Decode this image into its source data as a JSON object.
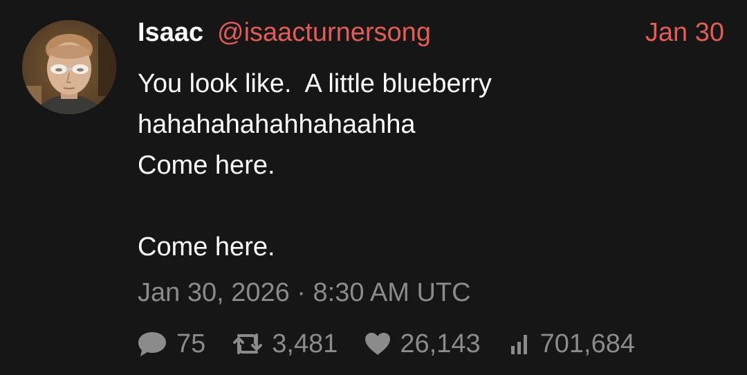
{
  "author": {
    "name": "Isaac",
    "handle": "@isaacturnersong",
    "date": "Jan 30",
    "avatar_icon": "profile-photo"
  },
  "body": {
    "lines": [
      "You look like.  A little blueberry",
      "hahahahahahhahaahha",
      "Come here.",
      "",
      "Come here."
    ]
  },
  "timestamp": "Jan 30, 2026 · 8:30 AM UTC",
  "stats": {
    "replies": "75",
    "reposts": "3,481",
    "likes": "26,143",
    "views": "701,684"
  },
  "icons": {
    "reply": "speech-bubble-icon",
    "repost": "retweet-arrows-icon",
    "like": "heart-icon",
    "views": "bar-chart-icon"
  },
  "colors": {
    "background": "#161616",
    "handle": "#e35d55",
    "muted": "#8b8b8b",
    "text": "#ffffff"
  }
}
